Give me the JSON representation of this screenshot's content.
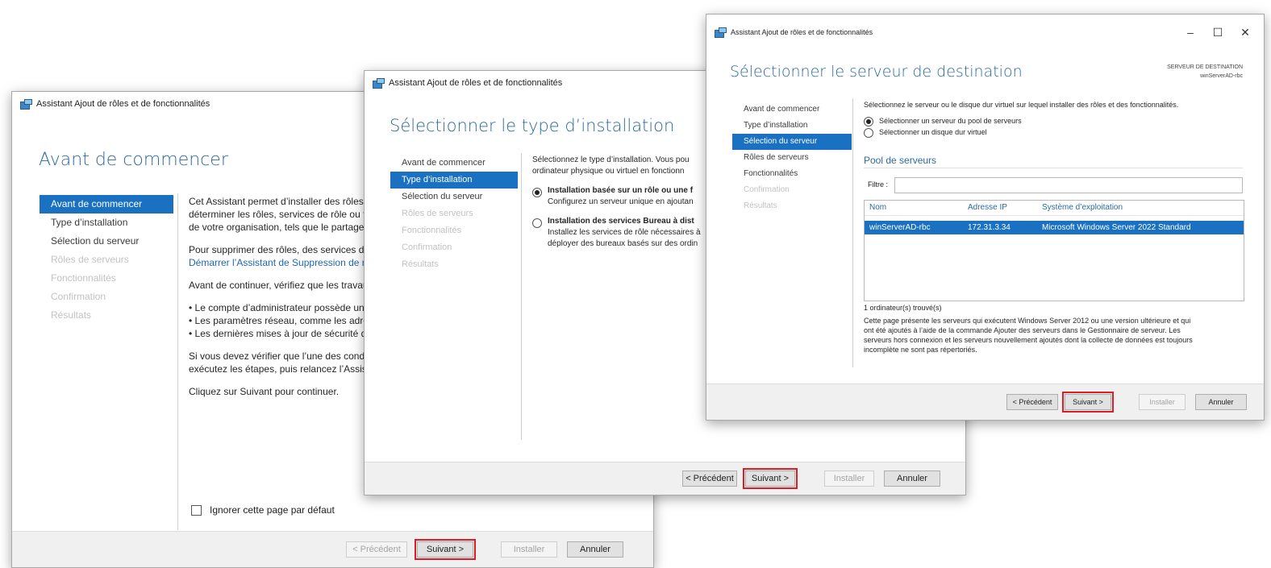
{
  "windows": {
    "w1": {
      "title": "Assistant Ajout de rôles et de fonctionnalités",
      "heading": "Avant de commencer",
      "nav": [
        {
          "label": "Avant de commencer",
          "state": "active"
        },
        {
          "label": "Type d’installation",
          "state": "normal"
        },
        {
          "label": "Sélection du serveur",
          "state": "normal"
        },
        {
          "label": "Rôles de serveurs",
          "state": "disabled"
        },
        {
          "label": "Fonctionnalités",
          "state": "disabled"
        },
        {
          "label": "Confirmation",
          "state": "disabled"
        },
        {
          "label": "Résultats",
          "state": "disabled"
        }
      ],
      "content": {
        "p1": [
          "Cet Assistant permet d’installer des rôles,",
          "déterminer les rôles, services de rôle ou f",
          "de votre organisation, tels que le partage"
        ],
        "p2_line1": "Pour supprimer des rôles, des services de",
        "p2_link": "Démarrer l’Assistant de Suppression de rô",
        "p3": "Avant de continuer, vérifiez que les travau",
        "bullets": [
          "Le compte d’administrateur possède un",
          "Les paramètres réseau, comme les adres",
          "Les dernières mises à jour de sécurité d"
        ],
        "p4": [
          "Si vous devez vérifier que l’une des condi",
          "exécutez les étapes, puis relancez l’Assista"
        ],
        "p5": "Cliquez sur Suivant pour continuer.",
        "checkbox_label": "Ignorer cette page par défaut"
      },
      "buttons": {
        "prev": "< Précédent",
        "next": "Suivant >",
        "install": "Installer",
        "cancel": "Annuler"
      }
    },
    "w2": {
      "title": "Assistant Ajout de rôles et de fonctionnalités",
      "heading": "Sélectionner le type d’installation",
      "nav": [
        {
          "label": "Avant de commencer",
          "state": "normal"
        },
        {
          "label": "Type d’installation",
          "state": "active"
        },
        {
          "label": "Sélection du serveur",
          "state": "normal"
        },
        {
          "label": "Rôles de serveurs",
          "state": "disabled"
        },
        {
          "label": "Fonctionnalités",
          "state": "disabled"
        },
        {
          "label": "Confirmation",
          "state": "disabled"
        },
        {
          "label": "Résultats",
          "state": "disabled"
        }
      ],
      "content": {
        "intro": [
          "Sélectionnez le type d’installation. Vous pou",
          "ordinateur physique ou virtuel en fonctionn"
        ],
        "opt1_title": "Installation basée sur un rôle ou une f",
        "opt1_desc": "Configurez un serveur unique en ajoutan",
        "opt2_title": "Installation des services Bureau à dist",
        "opt2_desc": [
          "Installez les services de rôle nécessaires à",
          "déployer des bureaux basés sur des ordin"
        ]
      },
      "buttons": {
        "prev": "< Précédent",
        "next": "Suivant >",
        "install": "Installer",
        "cancel": "Annuler"
      }
    },
    "w3": {
      "title": "Assistant Ajout de rôles et de fonctionnalités",
      "heading": "Sélectionner le serveur de destination",
      "server_label": "SERVEUR DE DESTINATION",
      "server_name": "winServerAD-rbc",
      "controls": {
        "minimize": "–",
        "maximize": "☐",
        "close": "✕"
      },
      "nav": [
        {
          "label": "Avant de commencer",
          "state": "normal"
        },
        {
          "label": "Type d’installation",
          "state": "normal"
        },
        {
          "label": "Sélection du serveur",
          "state": "active"
        },
        {
          "label": "Rôles de serveurs",
          "state": "normal"
        },
        {
          "label": "Fonctionnalités",
          "state": "normal"
        },
        {
          "label": "Confirmation",
          "state": "disabled"
        },
        {
          "label": "Résultats",
          "state": "disabled"
        }
      ],
      "content": {
        "intro": "Sélectionnez le serveur ou le disque dur virtuel sur lequel installer des rôles et des fonctionnalités.",
        "opt1": "Sélectionner un serveur du pool de serveurs",
        "opt2": "Sélectionner un disque dur virtuel",
        "pool_title": "Pool de serveurs",
        "filter_label": "Filtre :",
        "columns": [
          "Nom",
          "Adresse IP",
          "Système d’exploitation"
        ],
        "rows": [
          [
            "winServerAD-rbc",
            "172.31.3.34",
            "Microsoft Windows Server 2022 Standard"
          ]
        ],
        "count": "1 ordinateur(s) trouvé(s)",
        "description": [
          "Cette page présente les serveurs qui exécutent Windows Server 2012 ou une version ultérieure et qui",
          "ont été ajoutés à l’aide de la commande Ajouter des serveurs dans le Gestionnaire de serveur. Les",
          "serveurs hors connexion et les serveurs nouvellement ajoutés dont la collecte de données est toujours",
          "incomplète ne sont pas répertoriés."
        ]
      },
      "buttons": {
        "prev": "< Précédent",
        "next": "Suivant >",
        "install": "Installer",
        "cancel": "Annuler"
      }
    }
  },
  "colors": {
    "accent": "#1a71c2",
    "heading": "#2b6a9e",
    "highlight": "#e11b22"
  }
}
